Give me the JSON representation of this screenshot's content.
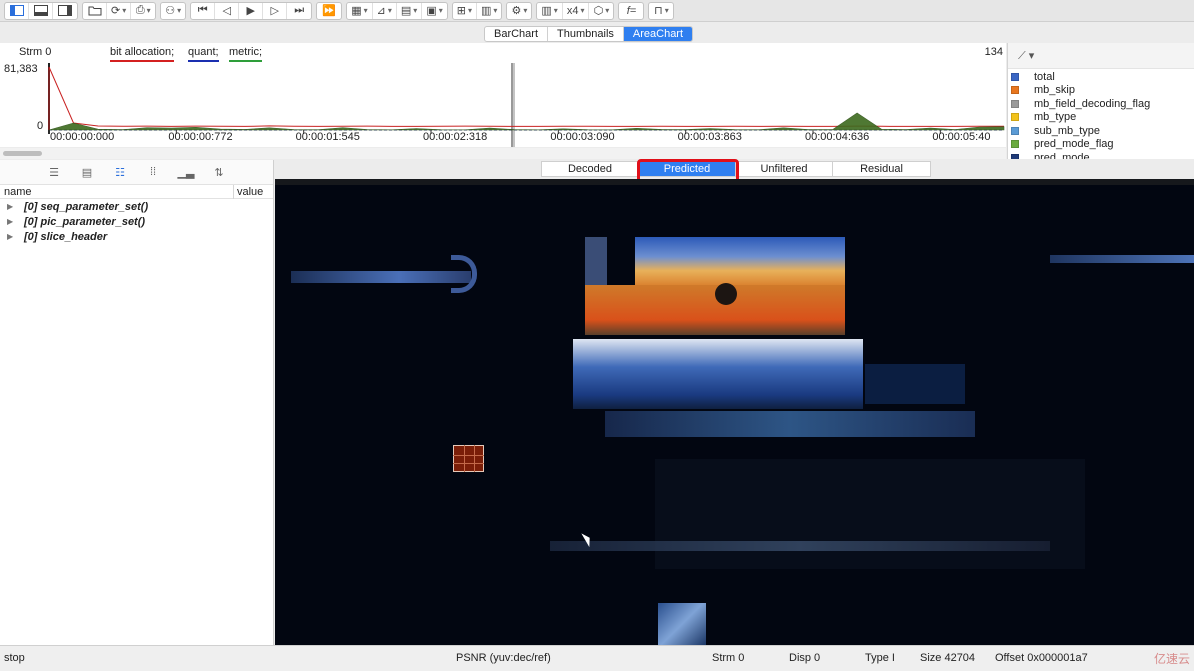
{
  "toolbar": {
    "zoom_label": "x4",
    "formula_label": "f="
  },
  "chart_tabs": [
    "BarChart",
    "Thumbnails",
    "AreaChart"
  ],
  "chart_tab_selected": "AreaChart",
  "chart_panel": {
    "stream_label": "Strm 0",
    "legend": [
      {
        "label": "bit allocation;",
        "color": "#d42020"
      },
      {
        "label": "quant;",
        "color": "#1a2fb0"
      },
      {
        "label": "metric;",
        "color": "#2e9e3a"
      }
    ],
    "x_count": "134"
  },
  "chart_data": {
    "type": "area",
    "ylim": [
      0,
      81383
    ],
    "y_tick_labels": [
      "81,383",
      "0"
    ],
    "x_tick_labels": [
      "00:00:00:000",
      "00:00:00:772",
      "00:00:01:545",
      "00:00:02:318",
      "00:00:03:090",
      "00:00:03:863",
      "00:00:04:636",
      "00:00:05:40"
    ],
    "series": [
      {
        "name": "bit allocation",
        "values": [
          81383,
          9000,
          5200,
          4800,
          5000,
          4700,
          5100,
          4900,
          4600,
          5300,
          4800,
          4700,
          4900,
          5100,
          4700,
          4600,
          4800,
          5000,
          4900,
          4700,
          4600,
          4800,
          4900,
          4700,
          4600,
          4800,
          4700,
          4600,
          4900,
          4700,
          4800,
          4600,
          4700,
          5000,
          4800,
          4700,
          4600,
          4700,
          4800,
          4900
        ]
      },
      {
        "name": "mb_skip",
        "values": [
          0,
          9000,
          1000,
          500,
          3000,
          2500,
          3500,
          1200,
          800,
          2800,
          600,
          400,
          3000,
          500,
          300,
          2000,
          400,
          300,
          2400,
          500,
          300,
          1500,
          400,
          300,
          2200,
          800,
          500,
          1800,
          700,
          400,
          2800,
          600,
          500,
          22000,
          900,
          600,
          2500,
          700,
          3800,
          4200
        ]
      }
    ]
  },
  "legend_panel": {
    "items": [
      {
        "label": "total",
        "color": "#3a66c4"
      },
      {
        "label": "mb_skip",
        "color": "#e8761e"
      },
      {
        "label": "mb_field_decoding_flag",
        "color": "#9a9a9a"
      },
      {
        "label": "mb_type",
        "color": "#f2c21a"
      },
      {
        "label": "sub_mb_type",
        "color": "#5b9bd5"
      },
      {
        "label": "pred_mode_flag",
        "color": "#6aab3f"
      },
      {
        "label": "pred_mode",
        "color": "#1f3a78"
      }
    ]
  },
  "tree": {
    "columns": {
      "name": "name",
      "value": "value"
    },
    "rows": [
      {
        "label": "[0] seq_parameter_set()"
      },
      {
        "label": "[0] pic_parameter_set()"
      },
      {
        "label": "[0] slice_header"
      }
    ]
  },
  "video_tabs": [
    "Decoded",
    "Predicted",
    "Unfiltered",
    "Residual"
  ],
  "video_tab_selected": "Predicted",
  "status": {
    "state": "stop",
    "psnr": "PSNR (yuv:dec/ref)",
    "strm": "Strm 0",
    "disp": "Disp 0",
    "type": "Type I",
    "size": "Size 42704",
    "offset": "Offset 0x000001a7",
    "watermark": "亿速云"
  }
}
